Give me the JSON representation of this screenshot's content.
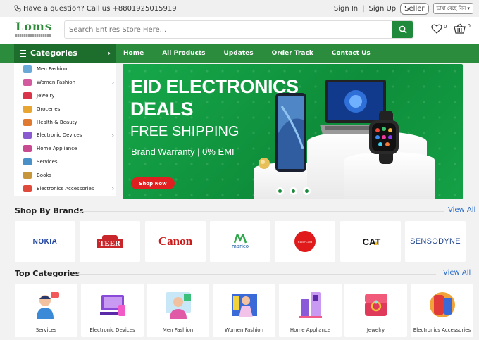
{
  "topbar": {
    "contact": "Have a question? Call us +8801925015919",
    "sign_in": "Sign In",
    "separator": "|",
    "sign_up": "Sign Up",
    "seller": "Seller",
    "language": "ভাষা বেছে নিন"
  },
  "header": {
    "logo_text": "Loms",
    "search_placeholder": "Search Entires Store Here...",
    "wishlist_count": "0",
    "cart_count": "0"
  },
  "nav": {
    "categories_label": "Categories",
    "links": [
      "Home",
      "All Products",
      "Updates",
      "Order Track",
      "Contact Us"
    ]
  },
  "sidebar": {
    "items": [
      {
        "label": "Men Fashion",
        "has_sub": false,
        "color": "#6aa8d8"
      },
      {
        "label": "Women Fashion",
        "has_sub": true,
        "color": "#d45aa0"
      },
      {
        "label": "Jewelry",
        "has_sub": false,
        "color": "#d9344a"
      },
      {
        "label": "Groceries",
        "has_sub": false,
        "color": "#e8a530"
      },
      {
        "label": "Health & Beauty",
        "has_sub": false,
        "color": "#e07a30"
      },
      {
        "label": "Electronic Devices",
        "has_sub": true,
        "color": "#8a5ad0"
      },
      {
        "label": "Home Appliance",
        "has_sub": false,
        "color": "#c84a90"
      },
      {
        "label": "Services",
        "has_sub": false,
        "color": "#4a90c8"
      },
      {
        "label": "Books",
        "has_sub": false,
        "color": "#c8963a"
      },
      {
        "label": "Electronics Accessories",
        "has_sub": true,
        "color": "#e04a3a"
      }
    ]
  },
  "banner": {
    "title_line1": "EID ELECTRONICS",
    "title_line2": "DEALS",
    "subtitle": "FREE SHIPPING",
    "tagline": "Brand Warranty | 0% EMI",
    "cta": "Shop Now"
  },
  "brands": {
    "title": "Shop By Brands",
    "view_all": "View All",
    "items": [
      "NOKIA",
      "TEER",
      "Canon",
      "marico",
      "Coca-Cola",
      "CAT",
      "SENSODYNE"
    ]
  },
  "top_categories": {
    "title": "Top Categories",
    "view_all": "View All",
    "items": [
      "Services",
      "Electronic Devices",
      "Men Fashion",
      "Women Fashion",
      "Home Appliance",
      "Jewelry",
      "Electronics Accessories"
    ]
  },
  "colors": {
    "brand_green": "#2a8c3c",
    "dark_green": "#1d6e2d",
    "cta_red": "#e02020",
    "link_blue": "#2a6bc9"
  }
}
